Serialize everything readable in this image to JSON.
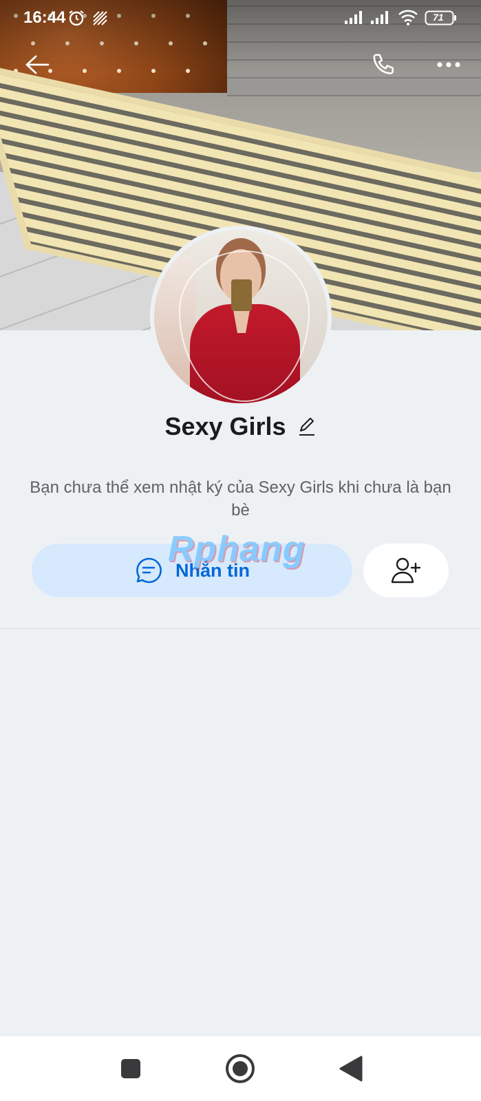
{
  "status_bar": {
    "time": "16:44",
    "battery": "71"
  },
  "header": {
    "back_icon": "arrow-left-icon",
    "call_icon": "phone-icon",
    "more_icon": "more-horizontal-icon"
  },
  "profile": {
    "name": "Sexy Girls",
    "edit_icon": "pencil-icon",
    "notice": "Bạn chưa thể xem nhật ký của Sexy Girls khi chưa là bạn bè"
  },
  "actions": {
    "message_label": "Nhắn tin",
    "message_icon": "chat-bubble-icon",
    "add_friend_icon": "add-user-icon"
  },
  "watermark": "Rphang",
  "colors": {
    "accent": "#0068d6",
    "message_button_bg": "#d7e9fd",
    "page_bg": "#eef1f4"
  },
  "nav": {
    "recents_icon": "square-icon",
    "home_icon": "circle-icon",
    "back_icon": "triangle-back-icon"
  }
}
